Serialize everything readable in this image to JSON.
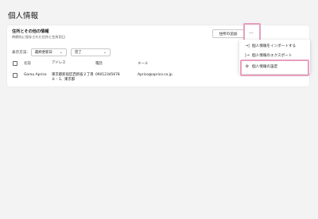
{
  "page": {
    "title": "個人情報"
  },
  "section": {
    "title": "住所とその他の情報",
    "subtitle": "時節的に保存された住所と住所用日"
  },
  "toolbar": {
    "add_address_label": "住所の追加",
    "more_label": "···"
  },
  "filters": {
    "display_label": "表示方法:",
    "sort_value": "最終更新日",
    "status_value": "完了"
  },
  "table": {
    "columns": [
      "名前",
      "アドレス",
      "電話",
      "メール"
    ],
    "rows": [
      {
        "name": "Gorou Aprico",
        "address": "東京都新宿区西新宿２丁目８ - 1、東京都",
        "phone": "09012345678",
        "email": "Aprico@aprico.co.jp"
      }
    ]
  },
  "menu": {
    "items": [
      {
        "label": "個人情報をインポートする",
        "icon": "import-icon",
        "glyph": "→|"
      },
      {
        "label": "個人情報のエクスポート",
        "icon": "export-icon",
        "glyph": "|→"
      },
      {
        "label": "個人情報の設定",
        "icon": "gear-icon",
        "glyph": "⚙"
      }
    ]
  },
  "colors": {
    "highlight": "#e89fbe",
    "background": "#f3f3f3",
    "card": "#ffffff"
  }
}
